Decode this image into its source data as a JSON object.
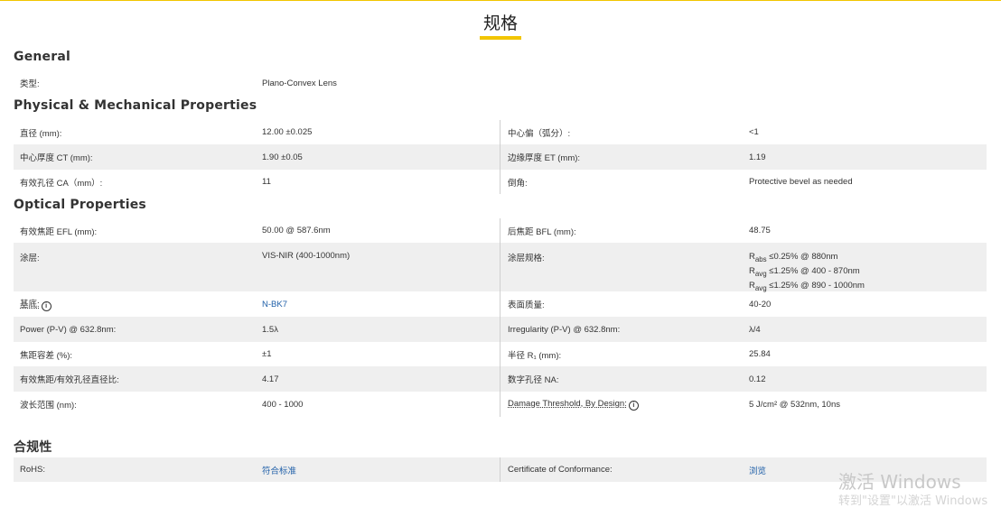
{
  "page": {
    "title": "规格"
  },
  "general": {
    "title": "General",
    "type_label": "类型:",
    "type_value": "Plano-Convex Lens"
  },
  "physical": {
    "title": "Physical & Mechanical Properties",
    "rows": [
      {
        "l1": "直径 (mm):",
        "v1": "12.00 ±0.025",
        "l2": "中心偏（弧分）:",
        "v2": "<1"
      },
      {
        "l1": "中心厚度 CT (mm):",
        "v1": "1.90 ±0.05",
        "l2": "边缘厚度 ET (mm):",
        "v2": "1.19"
      },
      {
        "l1": "有效孔径 CA（mm）:",
        "v1": "11",
        "l2": "倒角:",
        "v2": "Protective bevel as needed"
      }
    ]
  },
  "optical": {
    "title": "Optical Properties",
    "efl_label": "有效焦距 EFL (mm):",
    "efl_value": "50.00 @ 587.6nm",
    "bfl_label": "后焦距 BFL (mm):",
    "bfl_value": "48.75",
    "coating_label": "涂层:",
    "coating_value": "VIS-NIR (400-1000nm)",
    "coating_spec_label": "涂层规格:",
    "coating_spec_lines": [
      "R<sub>abs</sub> ≤0.25% @ 880nm",
      "R<sub>avg</sub> ≤1.25% @ 400 - 870nm",
      "R<sub>avg</sub> ≤1.25% @ 890 - 1000nm"
    ],
    "substrate_label": "基底:",
    "substrate_value": "N-BK7",
    "surface_quality_label": "表面质量:",
    "surface_quality_value": "40-20",
    "power_label": "Power (P-V) @ 632.8nm:",
    "power_value": "1.5λ",
    "irregularity_label": "Irregularity (P-V) @ 632.8nm:",
    "irregularity_value": "λ/4",
    "focal_tol_label": "焦距容差 (%):",
    "focal_tol_value": "±1",
    "radius_label": "半径 R₁ (mm):",
    "radius_value": "25.84",
    "fnum_label": "有效焦距/有效孔径直径比:",
    "fnum_value": "4.17",
    "na_label": "数字孔径 NA:",
    "na_value": "0.12",
    "wavelength_label": "波长范围 (nm):",
    "wavelength_value": "400 - 1000",
    "damage_label": "Damage Threshold, By Design:",
    "damage_value": "5 J/cm² @ 532nm, 10ns"
  },
  "compliance": {
    "title": "合规性",
    "rohs_label": "RoHS:",
    "rohs_value": "符合标准",
    "coc_label": "Certificate of Conformance:",
    "coc_value": "浏览"
  },
  "watermark": {
    "line1": "激活 Windows",
    "line2": "转到\"设置\"以激活 Windows"
  }
}
